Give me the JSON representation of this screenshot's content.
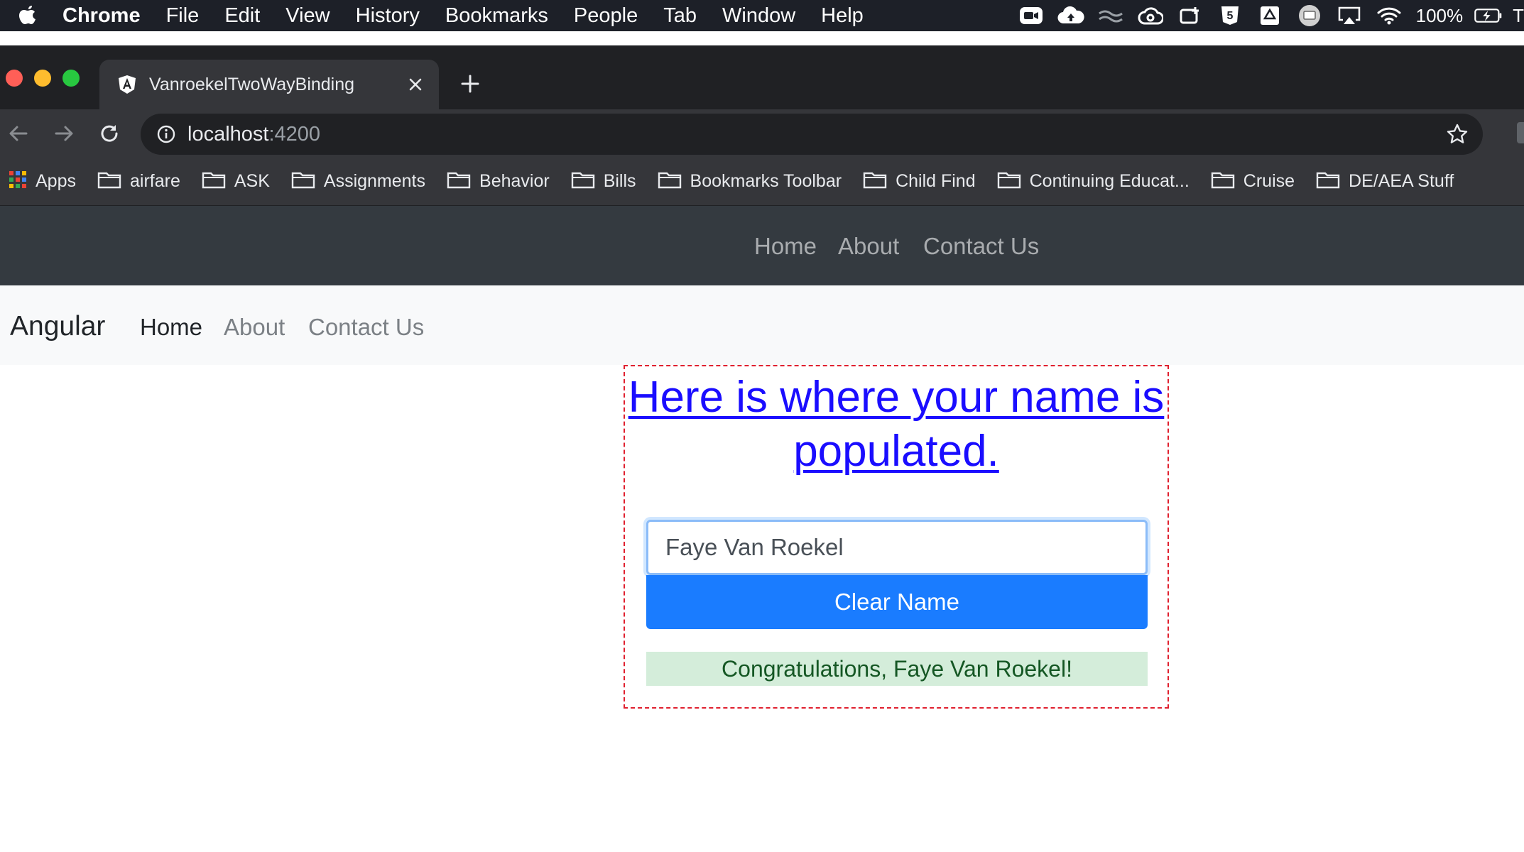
{
  "menubar": {
    "items": [
      "Chrome",
      "File",
      "Edit",
      "View",
      "History",
      "Bookmarks",
      "People",
      "Tab",
      "Window",
      "Help"
    ],
    "battery": "100%",
    "trailing": "T"
  },
  "browser": {
    "tab_title": "VanroekelTwoWayBinding",
    "url_host": "localhost",
    "url_port": ":4200",
    "bookmarks": [
      "Apps",
      "airfare",
      "ASK",
      "Assignments",
      "Behavior",
      "Bills",
      "Bookmarks Toolbar",
      "Child Find",
      "Continuing Educat...",
      "Cruise",
      "DE/AEA Stuff"
    ]
  },
  "dark_nav": {
    "links": [
      "Home",
      "About",
      "Contact Us"
    ]
  },
  "light_nav": {
    "brand": "Angular",
    "links": [
      "Home",
      "About",
      "Contact Us"
    ]
  },
  "main": {
    "heading": "Here is where your name is populated.",
    "name_value": "Faye Van Roekel",
    "clear_button": "Clear Name",
    "congrats": "Congratulations, Faye Van Roekel!"
  },
  "colors": {
    "link_blue": "#1a0dff",
    "primary": "#1a7cff",
    "success_bg": "#d4edda",
    "success_text": "#155724",
    "dashed_border": "#e0202f"
  }
}
